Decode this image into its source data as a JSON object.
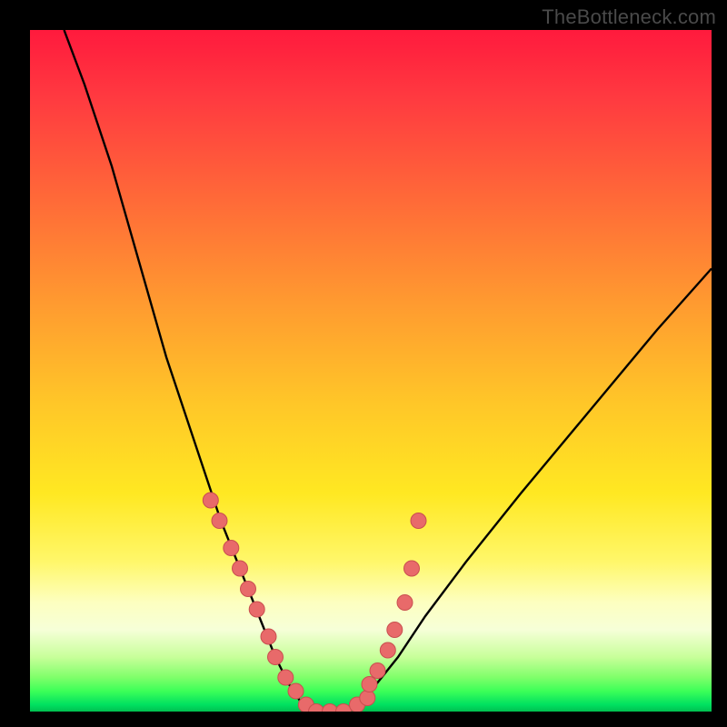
{
  "watermark": "TheBottleneck.com",
  "chart_data": {
    "type": "line",
    "title": "",
    "xlabel": "",
    "ylabel": "",
    "xlim": [
      0,
      100
    ],
    "ylim": [
      0,
      100
    ],
    "grid": false,
    "legend": false,
    "series": [
      {
        "name": "bottleneck-curve",
        "x": [
          5,
          8,
          12,
          16,
          20,
          24,
          26,
          28,
          30,
          32,
          34,
          36,
          38,
          40,
          42,
          44,
          46,
          48,
          50,
          54,
          58,
          64,
          72,
          82,
          92,
          100
        ],
        "y": [
          100,
          92,
          80,
          66,
          52,
          40,
          34,
          28,
          23,
          18,
          13,
          8,
          4,
          1,
          0,
          0,
          0,
          1,
          3,
          8,
          14,
          22,
          32,
          44,
          56,
          65
        ]
      }
    ],
    "marker_points": {
      "name": "highlighted-points",
      "x": [
        26.5,
        27.8,
        29.5,
        30.8,
        32.0,
        33.3,
        35.0,
        36.0,
        37.5,
        39.0,
        40.5,
        42.0,
        44.0,
        46.0,
        48.0,
        49.5,
        49.8,
        51.0,
        52.5,
        53.5,
        55.0,
        56.0,
        57.0
      ],
      "y": [
        31,
        28,
        24,
        21,
        18,
        15,
        11,
        8,
        5,
        3,
        1,
        0,
        0,
        0,
        1,
        2,
        4,
        6,
        9,
        12,
        16,
        21,
        28
      ]
    },
    "background_gradient": {
      "top_color": "#ff1a3d",
      "mid_color": "#ffe822",
      "bottom_color": "#00c050"
    }
  }
}
